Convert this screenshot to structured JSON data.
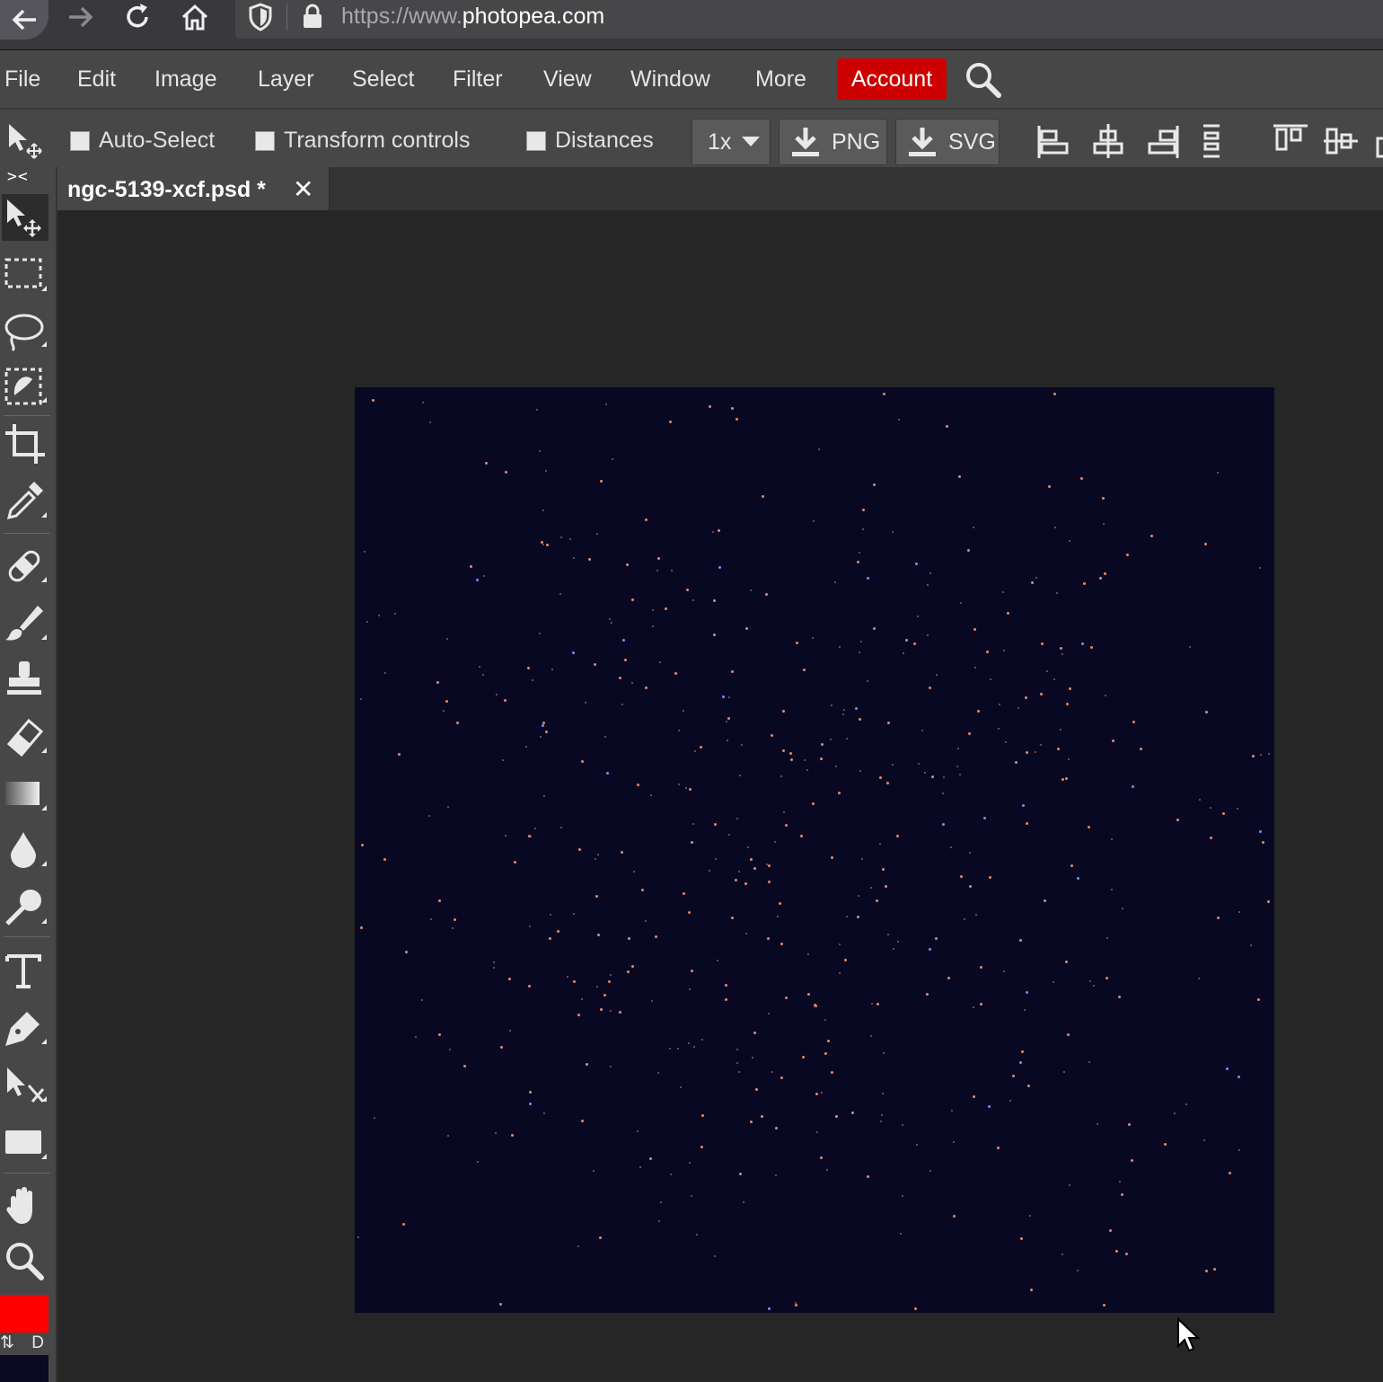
{
  "browser": {
    "url_prefix": "https://www.",
    "url_domain": "photopea.com"
  },
  "menu": {
    "items": [
      "File",
      "Edit",
      "Image",
      "Layer",
      "Select",
      "Filter",
      "View",
      "Window",
      "More"
    ],
    "account": "Account"
  },
  "options": {
    "auto_select": "Auto-Select",
    "transform_controls": "Transform controls",
    "distances": "Distances",
    "zoom": "1x",
    "png": "PNG",
    "svg": "SVG"
  },
  "toolbox": {
    "collapse": "><",
    "tools": [
      "move-tool",
      "rect-select-tool",
      "lasso-tool",
      "quick-select-tool",
      "crop-tool",
      "eyedropper-tool",
      "healing-tool",
      "brush-tool",
      "stamp-tool",
      "eraser-tool",
      "gradient-tool",
      "blur-tool",
      "dodge-tool",
      "type-tool",
      "pen-tool",
      "path-select-tool",
      "shape-tool",
      "hand-tool",
      "zoom-tool"
    ],
    "swap_label": "D",
    "foreground_color": "#ff0000",
    "background_color": "#0a0a22"
  },
  "document": {
    "tab_name": "ngc-5139-xcf.psd *",
    "close_glyph": "✕"
  },
  "colors": {
    "accent": "#cc0000",
    "canvas_bg": "#090822"
  }
}
